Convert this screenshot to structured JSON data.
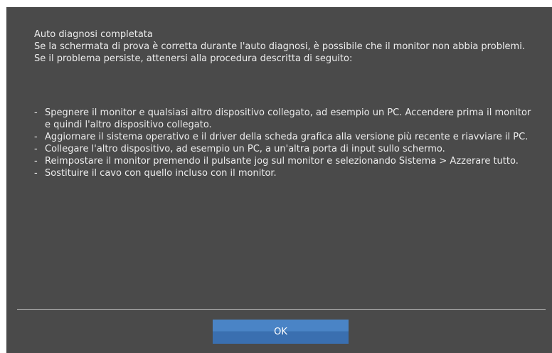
{
  "dialog": {
    "title": "Auto diagnosi completata",
    "description": "Se la schermata di prova è corretta durante l'auto diagnosi, è possibile che il monitor non abbia problemi. Se il problema persiste, attenersi alla procedura descritta di seguito:",
    "bullet": "-",
    "steps": [
      "Spegnere il monitor e qualsiasi altro dispositivo collegato, ad esempio un PC.  Accendere prima il monitor e quindi l'altro dispositivo collegato.",
      "Aggiornare il sistema operativo e il driver della scheda grafica alla versione più recente e riavviare il PC.",
      "Collegare l'altro dispositivo, ad esempio un PC, a un'altra porta di input sullo schermo.",
      "Reimpostare il monitor premendo il pulsante jog sul monitor e selezionando Sistema > Azzerare tutto.",
      "Sostituire il cavo con quello incluso con il monitor."
    ],
    "ok_label": "OK"
  },
  "colors": {
    "dialog_background": "#4a4a4a",
    "text": "#ececec",
    "button": "#4a84c6",
    "divider": "#bdbdbd"
  }
}
